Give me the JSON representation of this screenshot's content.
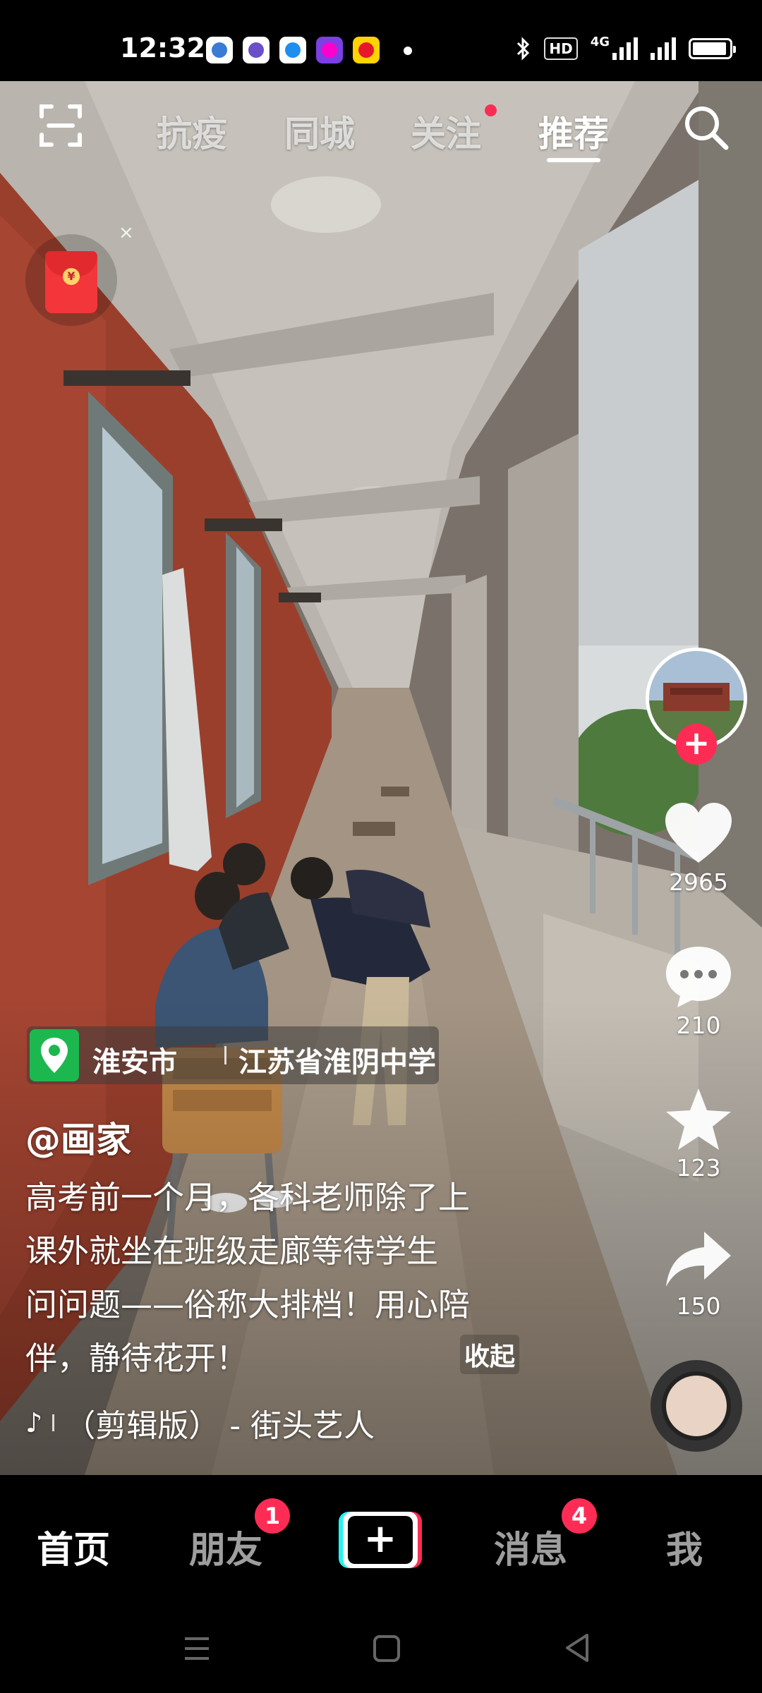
{
  "status_bar": {
    "time": "12:32",
    "hd_label": "HD",
    "network_label": "4G",
    "icons": [
      "bluetooth-icon",
      "signal-icon",
      "battery-icon"
    ]
  },
  "top_nav": {
    "tabs": [
      {
        "label": "抗疫",
        "active": false
      },
      {
        "label": "同城",
        "active": false
      },
      {
        "label": "关注",
        "active": false,
        "has_dot": true
      },
      {
        "label": "推荐",
        "active": true
      }
    ],
    "scan_icon": "scan-icon",
    "search_icon": "search-icon"
  },
  "red_packet": {
    "close_label": "×",
    "coin_label": "¥"
  },
  "video": {
    "location_city": "淮安市",
    "location_poi": "江苏省淮阴中学",
    "author": "@画家",
    "description_lines": [
      "高考前一个月，各科老师除了上",
      "课外就坐在班级走廊等待学生",
      "问问题——俗称大排档！用心陪",
      "伴，静待花开！"
    ],
    "collapse_label": "收起",
    "music": "（剪辑版） - 街头艺人"
  },
  "right_rail": {
    "follow_label": "+",
    "likes": "2965",
    "comments": "210",
    "favorites": "123",
    "shares": "150"
  },
  "bottom_nav": {
    "items": [
      {
        "label": "首页",
        "active": true
      },
      {
        "label": "朋友",
        "badge": "1"
      },
      {
        "label": "+"
      },
      {
        "label": "消息",
        "badge": "4"
      },
      {
        "label": "我"
      }
    ]
  },
  "colors": {
    "accent": "#fe2c55",
    "cyan": "#25f4ee",
    "location_green": "#1cb84f"
  }
}
